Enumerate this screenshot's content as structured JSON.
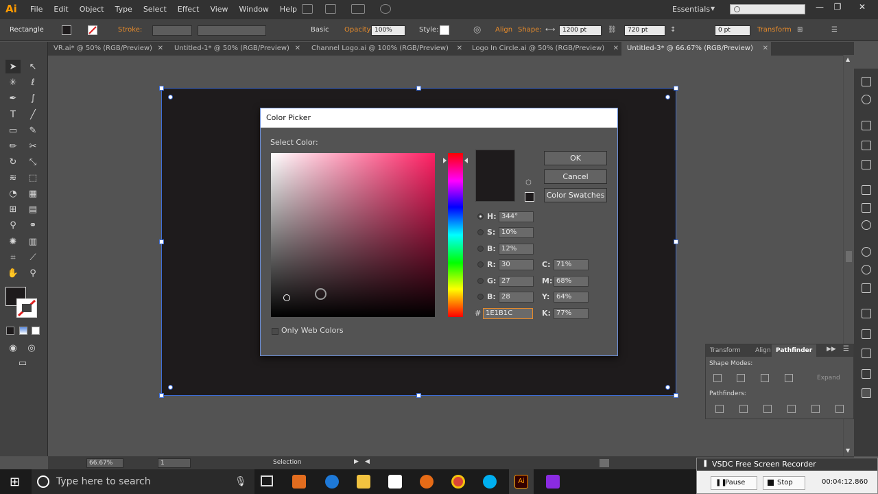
{
  "app": {
    "logo": "Ai",
    "menus": [
      "File",
      "Edit",
      "Object",
      "Type",
      "Select",
      "Effect",
      "View",
      "Window",
      "Help"
    ],
    "workspace": "Essentials"
  },
  "control_bar": {
    "tool_name": "Rectangle",
    "stroke_label": "Stroke:",
    "brush_label": "Basic",
    "opacity_label": "Opacity:",
    "opacity_value": "100%",
    "style_label": "Style:",
    "align_label": "Align",
    "shape_label": "Shape:",
    "width_value": "1200 pt",
    "height_value": "720 pt",
    "corner_value": "0 pt",
    "transform_label": "Transform"
  },
  "tabs": [
    {
      "label": "VR.ai* @ 50% (RGB/Preview)"
    },
    {
      "label": "Untitled-1* @ 50% (RGB/Preview)"
    },
    {
      "label": "Channel Logo.ai @ 100% (RGB/Preview)"
    },
    {
      "label": "Logo In Circle.ai @ 50% (RGB/Preview)"
    },
    {
      "label": "Untitled-3* @ 66.67% (RGB/Preview)"
    }
  ],
  "color_picker": {
    "title": "Color Picker",
    "select_color_label": "Select Color:",
    "ok_label": "OK",
    "cancel_label": "Cancel",
    "swatches_label": "Color Swatches",
    "h_label": "H:",
    "h_value": "344°",
    "s_label": "S:",
    "s_value": "10%",
    "b_label": "B:",
    "b_value": "12%",
    "r_label": "R:",
    "r_value": "30",
    "g_label": "G:",
    "g_value": "27",
    "blue_label": "B:",
    "blue_value": "28",
    "hex_label": "#",
    "hex_value": "1E1B1C",
    "c_label": "C:",
    "c_value": "71%",
    "m_label": "M:",
    "m_value": "68%",
    "y_label": "Y:",
    "y_value": "64%",
    "k_label": "K:",
    "k_value": "77%",
    "web_colors_label": "Only Web Colors",
    "current_color": "#1e1b1c"
  },
  "pathfinder": {
    "tabs": [
      "Transform",
      "Align",
      "Pathfinder"
    ],
    "shape_modes_label": "Shape Modes:",
    "expand_label": "Expand",
    "pathfinders_label": "Pathfinders:"
  },
  "status": {
    "zoom": "66.67%",
    "artboard_num": "1",
    "tool_status": "Selection"
  },
  "recorder": {
    "title": "VSDC Free Screen Recorder",
    "pause_label": "Pause",
    "stop_label": "Stop",
    "time": "00:04:12.860"
  },
  "taskbar": {
    "search_placeholder": "Type here to search"
  }
}
